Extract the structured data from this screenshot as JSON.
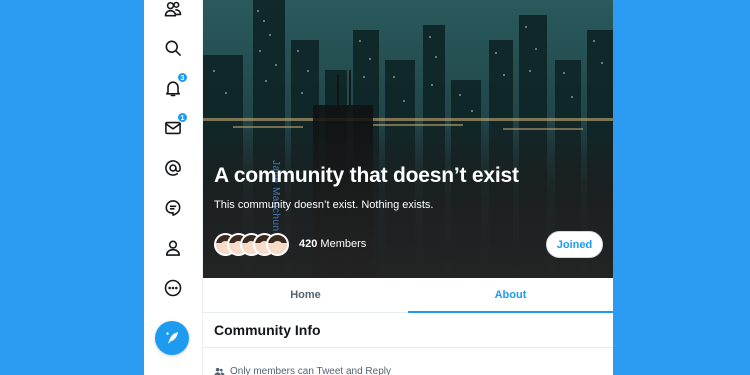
{
  "community": {
    "name": "A community that doesn’t exist",
    "description": "This community doesn’t exist. Nothing exists.",
    "member_count": "420",
    "members_label": "Members",
    "join_label": "Joined",
    "watermark": "Jane Manchun"
  },
  "sidebar": {
    "items": [
      {
        "name": "communities",
        "icon": "communities-icon"
      },
      {
        "name": "explore",
        "icon": "search-icon"
      },
      {
        "name": "notifications",
        "icon": "bell-icon",
        "badge": "3"
      },
      {
        "name": "messages",
        "icon": "mail-icon",
        "badge": "1"
      },
      {
        "name": "mentions",
        "icon": "at-icon"
      },
      {
        "name": "topics",
        "icon": "topics-icon"
      },
      {
        "name": "profile",
        "icon": "person-icon"
      },
      {
        "name": "more",
        "icon": "more-icon"
      }
    ],
    "compose_icon": "feather-plus-icon"
  },
  "tabs": [
    {
      "label": "Home",
      "active": false
    },
    {
      "label": "About",
      "active": true
    }
  ],
  "about": {
    "section_title": "Community Info",
    "rules": [
      {
        "icon": "people-icon",
        "text": "Only members can Tweet and Reply"
      }
    ]
  },
  "colors": {
    "accent": "#1d9bf0",
    "background": "#2b9cf2",
    "text": "#14171a",
    "secondary_text": "#536471"
  }
}
